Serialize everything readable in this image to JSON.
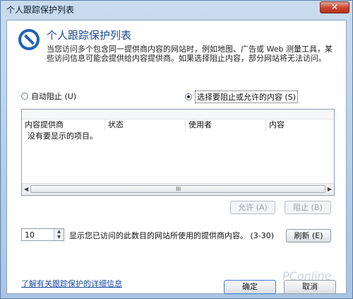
{
  "window": {
    "title": "个人跟踪保护列表",
    "close_glyph": "✕"
  },
  "header": {
    "heading": "个人跟踪保护列表",
    "description": "当您访问多个包含同一提供商内容的网站时，例如地图、广告或 Web 测量工具，某些访问信息可能会提供给内容提供商。如果选择阻止内容，部分网站将无法访问。"
  },
  "options": {
    "auto_block": "自动阻止 (U)",
    "choose_block": "选择要阻止或允许的内容 (S)",
    "selected": "choose_block"
  },
  "list": {
    "columns": [
      "内容提供商",
      "状态",
      "使用者",
      "内容"
    ],
    "empty_message": "没有要显示的项目。",
    "scroll_grip": "III"
  },
  "buttons": {
    "allow": "允许 (A)",
    "block": "阻止 (B)",
    "refresh": "刷新 (E)",
    "ok": "确定",
    "cancel": "取消"
  },
  "threshold": {
    "value": "10",
    "label": "显示您已访问的此数目的网站所使用的提供商内容。 (3-30)"
  },
  "footer": {
    "link": "了解有关跟踪保护的详细信息"
  },
  "watermark": "PConline"
}
